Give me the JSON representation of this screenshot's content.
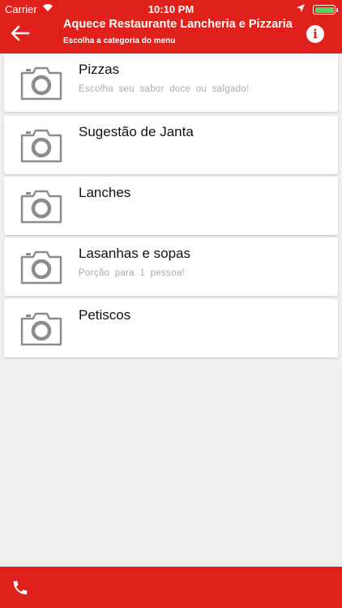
{
  "status_bar": {
    "carrier": "Carrier",
    "time": "10:10 PM"
  },
  "header": {
    "title": "Aquece Restaurante Lancheria e Pizzaria",
    "subtitle": "Escolha a categoria do menu",
    "back_icon": "arrow-left-icon",
    "info_icon": "info-icon",
    "info_glyph": "i",
    "color": "#e0211b"
  },
  "categories": [
    {
      "name": "Pizzas",
      "description": "Escolha seu sabor doce ou salgado!",
      "icon": "camera-placeholder-icon"
    },
    {
      "name": "Sugestão de Janta",
      "description": "",
      "icon": "camera-placeholder-icon"
    },
    {
      "name": "Lanches",
      "description": "",
      "icon": "camera-placeholder-icon"
    },
    {
      "name": "Lasanhas e sopas",
      "description": "Porção para 1 pessoa!",
      "icon": "camera-placeholder-icon"
    },
    {
      "name": "Petiscos",
      "description": "",
      "icon": "camera-placeholder-icon"
    }
  ],
  "bottom_bar": {
    "phone_icon": "phone-icon"
  }
}
